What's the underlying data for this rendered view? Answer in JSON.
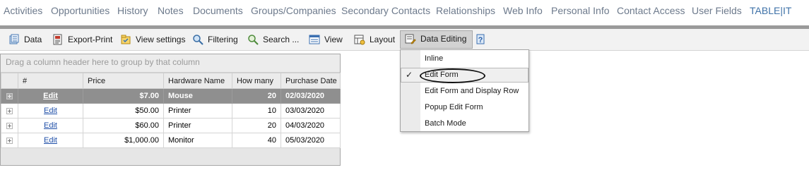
{
  "tabs": [
    {
      "label": "Activities",
      "active": false
    },
    {
      "label": "Opportunities",
      "active": false
    },
    {
      "label": "History",
      "active": false
    },
    {
      "label": "Notes",
      "active": false
    },
    {
      "label": "Documents",
      "active": false
    },
    {
      "label": "Groups/Companies",
      "active": false
    },
    {
      "label": "Secondary Contacts",
      "active": false
    },
    {
      "label": "Relationships",
      "active": false
    },
    {
      "label": "Web Info",
      "active": false
    },
    {
      "label": "Personal Info",
      "active": false
    },
    {
      "label": "Contact Access",
      "active": false
    },
    {
      "label": "User Fields",
      "active": false
    },
    {
      "label": "TABLE|IT",
      "active": true
    }
  ],
  "toolbar": {
    "data": "Data",
    "export_print": "Export-Print",
    "view_settings": "View settings",
    "filtering": "Filtering",
    "search": "Search ...",
    "view": "View",
    "layout": "Layout",
    "data_editing": "Data Editing",
    "help_icon": "help-icon"
  },
  "grid": {
    "group_panel": "Drag a column header here to group by that column",
    "columns": [
      "#",
      "Price",
      "Hardware Name",
      "How many",
      "Purchase Date"
    ],
    "rows": [
      {
        "link": "Edit",
        "price": "$7.00",
        "name": "Mouse",
        "qty": "20",
        "date": "02/03/2020"
      },
      {
        "link": "Edit",
        "price": "$50.00",
        "name": "Printer",
        "qty": "10",
        "date": "03/03/2020"
      },
      {
        "link": "Edit",
        "price": "$60.00",
        "name": "Printer",
        "qty": "20",
        "date": "04/03/2020"
      },
      {
        "link": "Edit",
        "price": "$1,000.00",
        "name": "Monitor",
        "qty": "40",
        "date": "05/03/2020"
      }
    ]
  },
  "menu": {
    "items": [
      {
        "label": "Inline",
        "checked": false
      },
      {
        "label": "Edit Form",
        "checked": true
      },
      {
        "label": "Edit Form and Display Row",
        "checked": false
      },
      {
        "label": "Popup Edit Form",
        "checked": false
      },
      {
        "label": "Batch Mode",
        "checked": false
      }
    ],
    "check_mark": "✓"
  },
  "colors": {
    "tab_text": "#6d7a8c",
    "tab_active": "#3f72a8",
    "selected_row": "#8f8f8f",
    "link": "#1f4fa8"
  }
}
